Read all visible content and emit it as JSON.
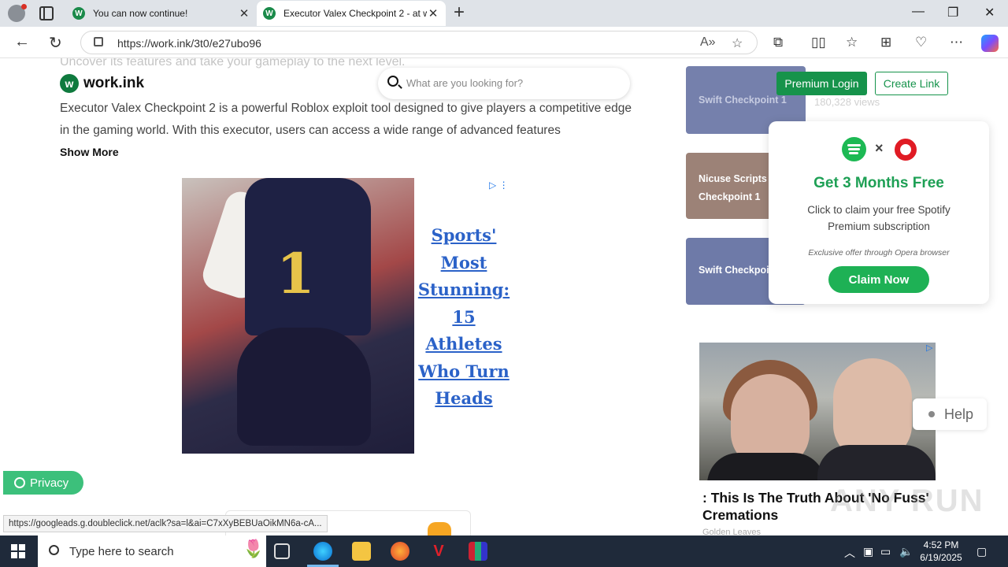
{
  "browser": {
    "tabs": [
      {
        "title": "You can now continue!",
        "favicon": "W",
        "active": false
      },
      {
        "title": "Executor Valex Checkpoint 2 - at w",
        "favicon": "W",
        "active": true
      }
    ],
    "url": "https://work.ink/3t0/e27ubo96",
    "status_url": "https://googleads.g.doubleclick.net/aclk?sa=l&ai=C7xXyBEBUaOikMN6a-cA..."
  },
  "site": {
    "logo_mark": "w",
    "logo_text": "work.ink",
    "search_placeholder": "What are you looking for?",
    "faded_top_text": "Uncover its features and take your gameplay to the next level.",
    "description": "Executor Valex Checkpoint 2 is a powerful Roblox exploit tool designed to give players a competitive edge in the gaming world. With this executor, users can access a wide range of advanced features",
    "show_more": "Show More",
    "premium_login": "Premium Login",
    "create_link": "Create Link",
    "privacy": "Privacy",
    "help": "Help"
  },
  "sidebar_cards": [
    {
      "title": "Swift Checkpoint 1",
      "views": "180,328 views"
    },
    {
      "title": "Nicuse Scripts Checkpoint 1"
    },
    {
      "title": "Swift Checkpoint 2"
    }
  ],
  "ad_left": {
    "headline": "Sports' Most Stunning: 15 Athletes Who Turn Heads",
    "jersey_number": "1"
  },
  "promo": {
    "times": "×",
    "title": "Get 3 Months Free",
    "subtitle": "Click to claim your free Spotify Premium subscription",
    "note": "Exclusive offer through Opera browser",
    "cta": "Claim Now",
    "colors": {
      "spotify": "#1db954",
      "opera": "#e01b24"
    }
  },
  "ad_right": {
    "headline": ": This Is The Truth About 'No Fuss' Cremations",
    "brand": "Golden Leaves"
  },
  "watermark": "ANY RUN",
  "taskbar": {
    "search_placeholder": "Type here to search",
    "time": "4:52 PM",
    "date": "6/19/2025"
  }
}
